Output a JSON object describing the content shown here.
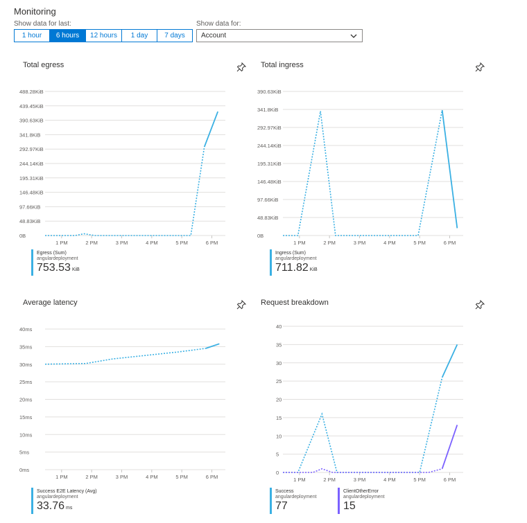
{
  "header": {
    "title": "Monitoring",
    "show_last_label": "Show data for last:",
    "show_for_label": "Show data for:",
    "time_ranges": [
      "1 hour",
      "6 hours",
      "12 hours",
      "1 day",
      "7 days"
    ],
    "active_range": "6 hours",
    "account_value": "Account"
  },
  "colors": {
    "accent": "#0078d4",
    "series_blue": "#3ab0e3",
    "series_purple": "#7b61ff",
    "grid": "#e1dfdd"
  },
  "tiles": {
    "egress": {
      "title": "Total egress",
      "legend": {
        "name": "Egress (Sum)",
        "resource": "angulardeployment",
        "value": "753.53",
        "unit": "KiB"
      }
    },
    "ingress": {
      "title": "Total ingress",
      "legend": {
        "name": "Ingress (Sum)",
        "resource": "angulardeployment",
        "value": "711.82",
        "unit": "KiB"
      }
    },
    "latency": {
      "title": "Average latency",
      "legend": {
        "name": "Success E2E Latency (Avg)",
        "resource": "angulardeployment",
        "value": "33.76",
        "unit": "ms"
      }
    },
    "requests": {
      "title": "Request breakdown",
      "legends": [
        {
          "name": "Success",
          "resource": "angulardeployment",
          "value": "77",
          "unit": ""
        },
        {
          "name": "ClientOtherError",
          "resource": "angulardeployment",
          "value": "15",
          "unit": ""
        }
      ]
    }
  },
  "chart_data": [
    {
      "type": "line",
      "title": "Total egress",
      "x_ticks": [
        "1 PM",
        "2 PM",
        "3 PM",
        "4 PM",
        "5 PM",
        "6 PM"
      ],
      "y_ticks": [
        "0B",
        "48.83KiB",
        "97.66KiB",
        "146.48KiB",
        "195.31KiB",
        "244.14KiB",
        "292.97KiB",
        "341.8KiB",
        "390.63KiB",
        "439.45KiB",
        "488.28KiB"
      ],
      "xlim": [
        12.45,
        18.45
      ],
      "ylim": [
        0,
        500
      ],
      "series": [
        {
          "name": "Egress (Sum)",
          "x": [
            12.45,
            13.45,
            13.75,
            14.1,
            17.3,
            17.75,
            18.2
          ],
          "y": [
            0,
            0,
            6,
            0,
            0,
            300,
            420
          ]
        }
      ]
    },
    {
      "type": "line",
      "title": "Total ingress",
      "x_ticks": [
        "1 PM",
        "2 PM",
        "3 PM",
        "4 PM",
        "5 PM",
        "6 PM"
      ],
      "y_ticks": [
        "0B",
        "48.83KiB",
        "97.66KiB",
        "146.48KiB",
        "195.31KiB",
        "244.14KiB",
        "292.97KiB",
        "341.8KiB",
        "390.63KiB"
      ],
      "xlim": [
        12.45,
        18.45
      ],
      "ylim": [
        0,
        400
      ],
      "series": [
        {
          "name": "Ingress (Sum)",
          "x": [
            12.45,
            12.95,
            13.7,
            14.2,
            16.95,
            17.75,
            18.25
          ],
          "y": [
            0,
            0,
            337,
            0,
            0,
            340,
            20
          ]
        }
      ]
    },
    {
      "type": "line",
      "title": "Average latency",
      "x_ticks": [
        "1 PM",
        "2 PM",
        "3 PM",
        "4 PM",
        "5 PM",
        "6 PM"
      ],
      "y_ticks": [
        "0ms",
        "5ms",
        "10ms",
        "15ms",
        "20ms",
        "25ms",
        "30ms",
        "35ms",
        "40ms"
      ],
      "xlim": [
        12.45,
        18.45
      ],
      "ylim": [
        0,
        40
      ],
      "series": [
        {
          "name": "Success E2E Latency (Avg)",
          "x": [
            12.45,
            13.8,
            14.7,
            15.8,
            16.9,
            17.8,
            18.25
          ],
          "y": [
            30,
            30.2,
            31.5,
            32.5,
            33.5,
            34.5,
            35.8
          ]
        }
      ]
    },
    {
      "type": "line",
      "title": "Request breakdown",
      "x_ticks": [
        "1 PM",
        "2 PM",
        "3 PM",
        "4 PM",
        "5 PM",
        "6 PM"
      ],
      "y_ticks": [
        "0",
        "5",
        "10",
        "15",
        "20",
        "25",
        "30",
        "35",
        "40"
      ],
      "xlim": [
        12.45,
        18.45
      ],
      "ylim": [
        0,
        40
      ],
      "series": [
        {
          "name": "Success",
          "x": [
            12.45,
            12.95,
            13.75,
            14.25,
            17.0,
            17.75,
            18.25
          ],
          "y": [
            0,
            0,
            16,
            0,
            0,
            26,
            35
          ]
        },
        {
          "name": "ClientOtherError",
          "x": [
            12.45,
            13.45,
            13.75,
            14.1,
            17.3,
            17.75,
            18.25
          ],
          "y": [
            0,
            0,
            1,
            0,
            0,
            1,
            13
          ]
        }
      ]
    }
  ]
}
